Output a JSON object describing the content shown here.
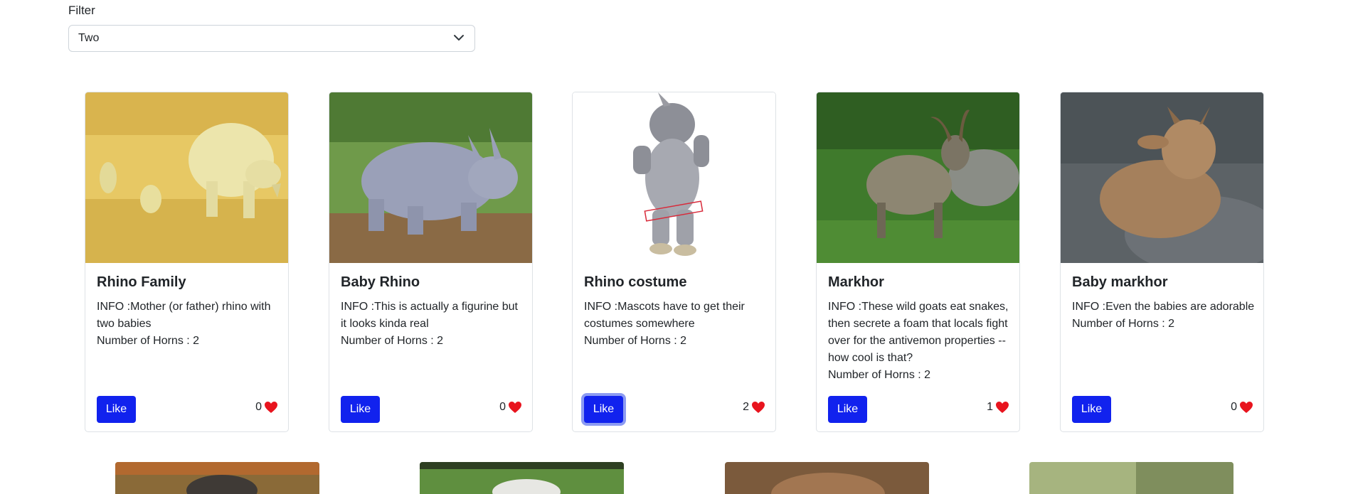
{
  "filter": {
    "label": "Filter",
    "selected": "Two"
  },
  "like_label": "Like",
  "cards": [
    {
      "title": "Rhino Family",
      "info": "INFO :Mother (or father) rhino with two babies",
      "horns": "Number of Horns : 2",
      "likes": "0"
    },
    {
      "title": "Baby Rhino",
      "info": "INFO :This is actually a figurine but it looks kinda real",
      "horns": "Number of Horns : 2",
      "likes": "0"
    },
    {
      "title": "Rhino costume",
      "info": "INFO :Mascots have to get their costumes somewhere",
      "horns": "Number of Horns : 2",
      "likes": "2"
    },
    {
      "title": "Markhor",
      "info": "INFO :These wild goats eat snakes, then secrete a foam that locals fight over for the antivemon properties -- how cool is that?",
      "horns": "Number of Horns : 2",
      "likes": "1"
    },
    {
      "title": "Baby markhor",
      "info": "INFO :Even the babies are adorable",
      "horns": "Number of Horns : 2",
      "likes": "0"
    }
  ],
  "colors": {
    "button": "#1122ee",
    "heart": "#e8141e"
  }
}
